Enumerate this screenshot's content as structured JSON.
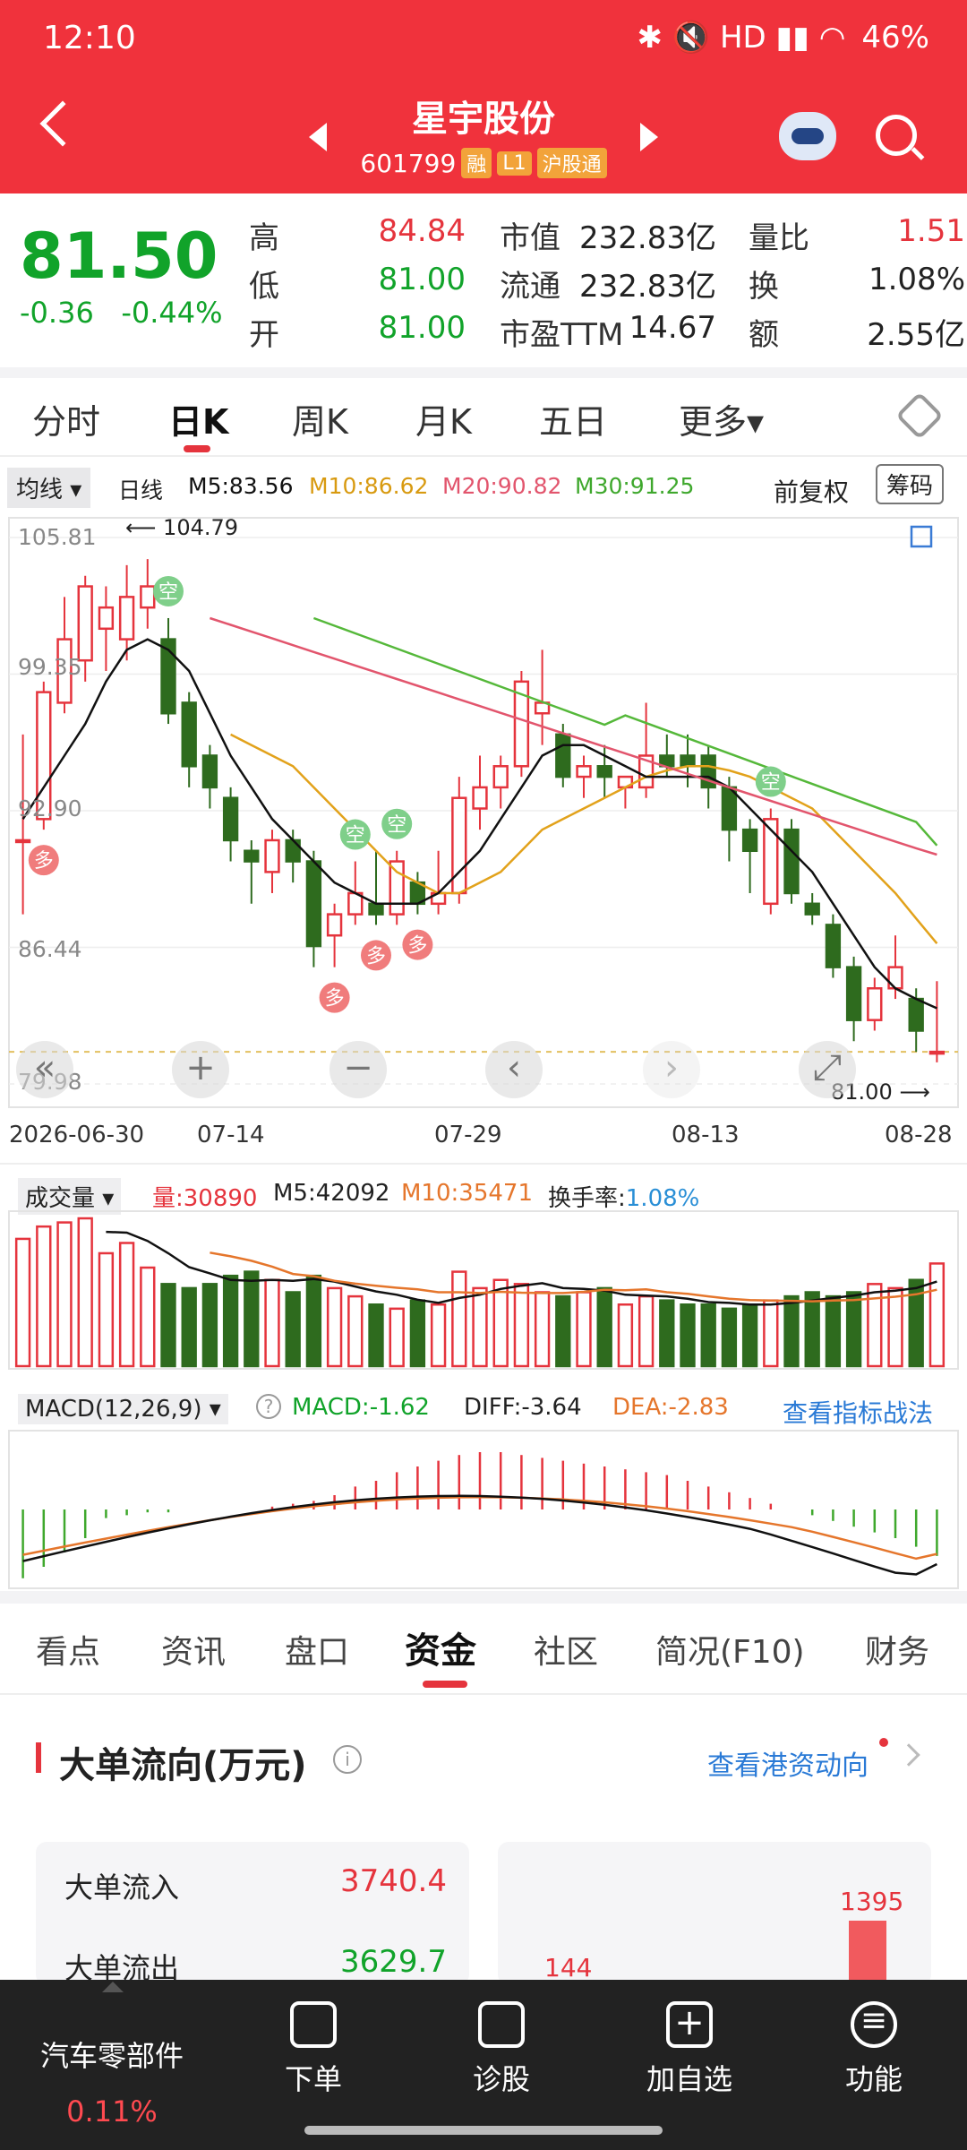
{
  "status": {
    "time": "12:10",
    "battery": "46%",
    "icons": "✱ 🔇 HD ▮▮ ◠"
  },
  "header": {
    "name": "星宇股份",
    "code": "601799",
    "tags": [
      "融",
      "L1",
      "沪股通"
    ]
  },
  "quote": {
    "price": "81.50",
    "change": "-0.36",
    "pct": "-0.44%",
    "rows": [
      {
        "l1": "高",
        "v1": "84.84",
        "l2": "市值",
        "v2": "232.83亿",
        "l3": "量比",
        "v3": "1.51"
      },
      {
        "l1": "低",
        "v1": "81.00",
        "l2": "流通",
        "v2": "232.83亿",
        "l3": "换",
        "v3": "1.08%"
      },
      {
        "l1": "开",
        "v1": "81.00",
        "l2": "市盈TTM",
        "v2": "14.67",
        "l3": "额",
        "v3": "2.55亿"
      }
    ]
  },
  "period_tabs": [
    "分时",
    "日K",
    "周K",
    "月K",
    "五日",
    "更多▾"
  ],
  "ma_bar": {
    "selector": "均线 ▾",
    "type": "日线",
    "ma5": "M5:83.56",
    "ma10": "M10:86.62",
    "ma20": "M20:90.82",
    "ma30": "M30:91.25",
    "adjust": "前复权",
    "chip": "筹码"
  },
  "colors": {
    "up": "#e5343d",
    "down": "#2e6b1e",
    "ma5": "#111111",
    "ma10": "#e2a21b",
    "ma20": "#e2556d",
    "ma30": "#55b83a",
    "brand": "#f0323c"
  },
  "chart_data": [
    {
      "type": "candlestick",
      "y_ticks": [
        "105.81",
        "99.35",
        "92.90",
        "86.44",
        "79.98"
      ],
      "ylim": [
        79.98,
        105.81
      ],
      "x_ticks": [
        "2026-06-30",
        "07-14",
        "07-29",
        "08-13",
        "08-28"
      ],
      "annotations": {
        "high": "104.79",
        "low": "81.00"
      },
      "candles": [
        {
          "o": 91.5,
          "c": 91.5,
          "h": 96.5,
          "l": 88.0
        },
        {
          "o": 92.5,
          "c": 98.5,
          "h": 99.0,
          "l": 92.0
        },
        {
          "o": 98.0,
          "c": 101.0,
          "h": 103.0,
          "l": 97.5
        },
        {
          "o": 100.0,
          "c": 103.5,
          "h": 104.0,
          "l": 99.0
        },
        {
          "o": 101.5,
          "c": 102.5,
          "h": 103.5,
          "l": 99.5
        },
        {
          "o": 101.0,
          "c": 103.0,
          "h": 104.5,
          "l": 100.0
        },
        {
          "o": 102.5,
          "c": 103.5,
          "h": 104.79,
          "l": 101.5
        },
        {
          "o": 101.0,
          "c": 97.5,
          "h": 102.0,
          "l": 97.0
        },
        {
          "o": 98.0,
          "c": 95.0,
          "h": 98.5,
          "l": 94.0
        },
        {
          "o": 95.5,
          "c": 94.0,
          "h": 96.0,
          "l": 93.0
        },
        {
          "o": 93.5,
          "c": 91.5,
          "h": 94.0,
          "l": 90.5
        },
        {
          "o": 91.0,
          "c": 90.5,
          "h": 91.5,
          "l": 88.5
        },
        {
          "o": 90.0,
          "c": 91.5,
          "h": 92.0,
          "l": 89.0
        },
        {
          "o": 91.5,
          "c": 90.5,
          "h": 92.0,
          "l": 89.5
        },
        {
          "o": 90.5,
          "c": 86.5,
          "h": 91.0,
          "l": 85.5
        },
        {
          "o": 87.0,
          "c": 88.0,
          "h": 88.5,
          "l": 85.5
        },
        {
          "o": 88.0,
          "c": 89.0,
          "h": 90.5,
          "l": 87.5
        },
        {
          "o": 88.5,
          "c": 88.0,
          "h": 91.0,
          "l": 87.5
        },
        {
          "o": 88.0,
          "c": 90.5,
          "h": 91.0,
          "l": 87.5
        },
        {
          "o": 89.5,
          "c": 88.5,
          "h": 90.0,
          "l": 88.0
        },
        {
          "o": 88.5,
          "c": 89.0,
          "h": 91.0,
          "l": 88.0
        },
        {
          "o": 89.0,
          "c": 93.5,
          "h": 94.5,
          "l": 88.5
        },
        {
          "o": 93.0,
          "c": 94.0,
          "h": 95.5,
          "l": 92.0
        },
        {
          "o": 94.0,
          "c": 95.0,
          "h": 95.5,
          "l": 93.0
        },
        {
          "o": 95.0,
          "c": 99.0,
          "h": 99.5,
          "l": 94.5
        },
        {
          "o": 97.5,
          "c": 98.0,
          "h": 100.5,
          "l": 96.0
        },
        {
          "o": 96.5,
          "c": 94.5,
          "h": 97.0,
          "l": 94.0
        },
        {
          "o": 94.5,
          "c": 95.0,
          "h": 95.5,
          "l": 93.5
        },
        {
          "o": 95.0,
          "c": 94.5,
          "h": 96.0,
          "l": 93.5
        },
        {
          "o": 94.0,
          "c": 94.5,
          "h": 94.5,
          "l": 93.0
        },
        {
          "o": 94.0,
          "c": 95.5,
          "h": 98.0,
          "l": 93.5
        },
        {
          "o": 95.5,
          "c": 95.0,
          "h": 96.5,
          "l": 94.5
        },
        {
          "o": 95.5,
          "c": 95.0,
          "h": 96.5,
          "l": 94.0
        },
        {
          "o": 95.5,
          "c": 94.0,
          "h": 96.0,
          "l": 93.0
        },
        {
          "o": 94.0,
          "c": 92.0,
          "h": 94.5,
          "l": 90.5
        },
        {
          "o": 92.0,
          "c": 91.0,
          "h": 92.5,
          "l": 89.0
        },
        {
          "o": 88.5,
          "c": 92.5,
          "h": 93.0,
          "l": 88.0
        },
        {
          "o": 92.0,
          "c": 89.0,
          "h": 92.5,
          "l": 88.5
        },
        {
          "o": 88.5,
          "c": 88.0,
          "h": 89.0,
          "l": 87.5
        },
        {
          "o": 87.5,
          "c": 85.5,
          "h": 88.0,
          "l": 85.0
        },
        {
          "o": 85.5,
          "c": 83.0,
          "h": 86.0,
          "l": 82.0
        },
        {
          "o": 83.0,
          "c": 84.5,
          "h": 85.0,
          "l": 82.5
        },
        {
          "o": 84.5,
          "c": 85.5,
          "h": 87.0,
          "l": 84.0
        },
        {
          "o": 84.0,
          "c": 82.5,
          "h": 84.5,
          "l": 81.5
        },
        {
          "o": 81.5,
          "c": 81.5,
          "h": 84.84,
          "l": 81.0
        }
      ],
      "ma5": [
        92.5,
        94.0,
        95.5,
        97.0,
        99.0,
        100.5,
        101.0,
        100.5,
        99.5,
        97.5,
        95.5,
        94.0,
        92.5,
        91.5,
        90.5,
        89.5,
        89.0,
        88.5,
        88.5,
        88.5,
        89.0,
        90.0,
        91.0,
        92.5,
        94.0,
        95.5,
        96.0,
        96.0,
        95.5,
        95.0,
        94.5,
        94.5,
        94.5,
        94.5,
        94.0,
        93.0,
        92.0,
        91.0,
        90.0,
        88.5,
        87.0,
        85.5,
        84.5,
        84.0,
        83.56
      ],
      "ma10": [
        null,
        null,
        null,
        null,
        null,
        null,
        null,
        null,
        null,
        null,
        96.5,
        96.0,
        95.5,
        95.0,
        94.0,
        93.0,
        92.0,
        91.0,
        90.0,
        89.5,
        89.0,
        89.0,
        89.5,
        90.0,
        91.0,
        92.0,
        92.5,
        93.0,
        93.5,
        94.0,
        94.5,
        94.8,
        95.0,
        95.0,
        94.8,
        94.5,
        94.0,
        93.5,
        93.0,
        92.0,
        91.0,
        90.0,
        89.0,
        87.8,
        86.62
      ],
      "ma20": [
        null,
        null,
        null,
        null,
        null,
        null,
        null,
        null,
        null,
        null,
        null,
        null,
        null,
        null,
        null,
        null,
        null,
        null,
        null,
        null,
        null,
        null,
        null,
        null,
        null,
        null,
        null,
        null,
        null,
        null,
        null,
        null,
        null,
        null,
        null,
        null,
        null,
        null,
        null,
        null,
        null,
        null,
        null,
        null,
        90.82
      ],
      "ma30": [
        null,
        null,
        null,
        null,
        null,
        null,
        null,
        null,
        null,
        null,
        null,
        null,
        null,
        null,
        null,
        null,
        null,
        null,
        null,
        null,
        null,
        null,
        null,
        null,
        null,
        null,
        null,
        null,
        null,
        null,
        null,
        null,
        null,
        null,
        null,
        null,
        null,
        null,
        null,
        null,
        null,
        null,
        null,
        null,
        91.25
      ],
      "markers": [
        {
          "i": 1,
          "label": "多",
          "kind": "buy"
        },
        {
          "i": 7,
          "label": "空",
          "kind": "sell"
        },
        {
          "i": 16,
          "label": "空",
          "kind": "sell"
        },
        {
          "i": 18,
          "label": "空",
          "kind": "sell"
        },
        {
          "i": 15,
          "label": "多",
          "kind": "buy"
        },
        {
          "i": 17,
          "label": "多",
          "kind": "buy"
        },
        {
          "i": 19,
          "label": "多",
          "kind": "buy"
        },
        {
          "i": 36,
          "label": "空",
          "kind": "sell"
        }
      ]
    },
    {
      "type": "bar",
      "name": "volume",
      "values": [
        62,
        68,
        70,
        72,
        55,
        60,
        48,
        40,
        38,
        40,
        44,
        46,
        42,
        36,
        44,
        38,
        34,
        30,
        28,
        32,
        30,
        46,
        38,
        42,
        40,
        36,
        34,
        36,
        38,
        30,
        34,
        32,
        30,
        30,
        28,
        30,
        32,
        34,
        36,
        34,
        36,
        40,
        38,
        42,
        50
      ]
    },
    {
      "type": "bar",
      "name": "MACD",
      "values": [
        -2.4,
        -2.0,
        -1.5,
        -1.0,
        -0.3,
        -0.2,
        -0.1,
        -0.1,
        0,
        0,
        0,
        0,
        0.1,
        0.2,
        0.3,
        0.5,
        0.8,
        1.0,
        1.3,
        1.5,
        1.7,
        1.9,
        2.0,
        2.0,
        1.9,
        1.8,
        1.7,
        1.6,
        1.5,
        1.4,
        1.3,
        1.2,
        1.0,
        0.8,
        0.6,
        0.4,
        0.2,
        0,
        -0.2,
        -0.4,
        -0.6,
        -0.8,
        -1.0,
        -1.3,
        -1.62
      ]
    }
  ],
  "volume_bar": {
    "selector": "成交量 ▾",
    "vol": "量:30890",
    "m5": "M5:42092",
    "m10": "M10:35471",
    "turnover_label": "换手率:",
    "turnover": "1.08%"
  },
  "macd_bar": {
    "selector": "MACD(12,26,9) ▾",
    "help": "?",
    "macd": "MACD:-1.62",
    "diff": "DIFF:-3.64",
    "dea": "DEA:-2.83",
    "link": "查看指标战法"
  },
  "info_tabs": [
    "看点",
    "资讯",
    "盘口",
    "资金",
    "社区",
    "简况(F10)",
    "财务"
  ],
  "fund": {
    "title": "大单流向(万元)",
    "info": "i",
    "link": "查看港资动向",
    "in_label": "大单流入",
    "in_value": "3740.4",
    "out_label": "大单流出",
    "out_value": "3629.7",
    "bar_left": "144",
    "bar_right": "1395"
  },
  "bottom_nav": {
    "sector": "汽车零部件",
    "sector_pct": "0.11%",
    "items": [
      "下单",
      "诊股",
      "加自选",
      "功能"
    ]
  }
}
